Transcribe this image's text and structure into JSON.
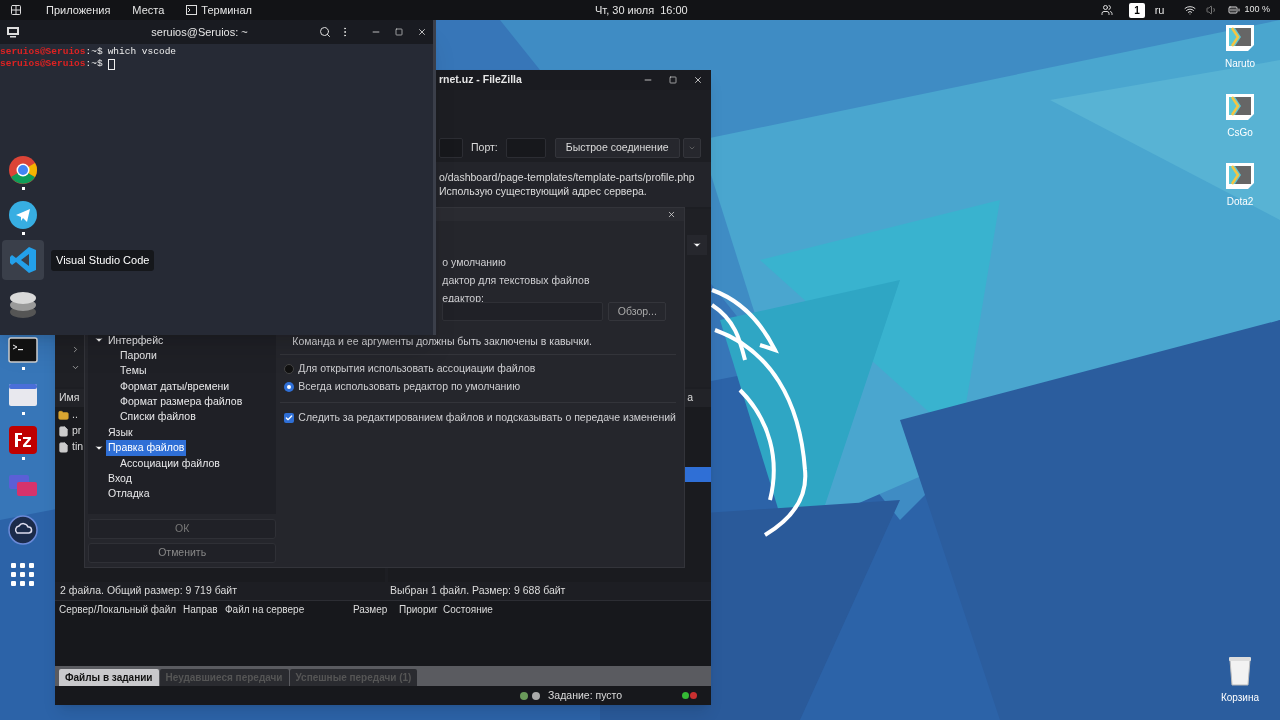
{
  "top_bar": {
    "menus": [
      "Приложения",
      "Места"
    ],
    "app": "Терминал",
    "clock": "Чт, 30 июля  16:00",
    "workspace": "1",
    "language": "ru",
    "battery": "100 %"
  },
  "dock": {
    "items": [
      {
        "kind": "chrome",
        "running": true,
        "highlighted": false
      },
      {
        "kind": "telegram",
        "running": true,
        "highlighted": false
      },
      {
        "kind": "vscode",
        "running": false,
        "highlighted": true
      },
      {
        "kind": "database",
        "running": false,
        "highlighted": false
      },
      {
        "kind": "terminal",
        "running": true,
        "highlighted": false
      },
      {
        "kind": "files",
        "running": true,
        "highlighted": false
      },
      {
        "kind": "filezilla",
        "running": true,
        "highlighted": false
      },
      {
        "kind": "screens",
        "running": false,
        "highlighted": false
      },
      {
        "kind": "cloud",
        "running": false,
        "highlighted": false
      },
      {
        "kind": "grid",
        "running": false,
        "highlighted": false
      }
    ],
    "tooltip": "Visual Studio Code"
  },
  "desktop_icons": [
    {
      "kind": "launcher",
      "label": "Naruto"
    },
    {
      "kind": "launcher",
      "label": "CsGo"
    },
    {
      "kind": "launcher",
      "label": "Dota2"
    },
    {
      "kind": "trash",
      "label": "Корзина"
    }
  ],
  "terminal": {
    "title": "seruios@Seruios: ~",
    "lines": [
      {
        "prompt": "seruios@Seruios",
        "path": ":~$",
        "command": "which vscode",
        "cursor": false
      },
      {
        "prompt": "seruios@Seruios",
        "path": ":~$",
        "cursor": true
      }
    ]
  },
  "filezilla": {
    "title": "rnet.uz - FileZilla",
    "port_label": "Порт:",
    "connect_button": "Быстрое соединение",
    "log": [
      "o/dashboard/page-templates/template-parts/profile.php",
      "Использую существующий адрес сервера."
    ],
    "local_header": "Имя",
    "local_rows": [
      {
        "kind": "folder",
        "name": ".."
      },
      {
        "kind": "file",
        "name": "pr"
      },
      {
        "kind": "file",
        "name": "tin"
      }
    ],
    "remote_header": "а",
    "remote_rows": [
      {
        "selected": false
      },
      {
        "selected": false
      },
      {
        "selected": false
      },
      {
        "selected": false
      },
      {
        "selected": true
      }
    ],
    "local_status": "2 файла. Общий размер: 9 719 байт",
    "remote_status": "Выбран 1 файл. Размер: 9 688 байт",
    "queue_columns": [
      "Сервер/Локальный файл",
      "Направ",
      "Файл на сервере",
      "Размер",
      "Приориг",
      "Состояние"
    ],
    "tabs": [
      {
        "label": "Файлы в задании",
        "selected": true
      },
      {
        "label": "Неудавшиеся передачи",
        "selected": false
      },
      {
        "label": "Успешные передачи (1)",
        "selected": false
      }
    ],
    "queue_status": "Задание: пусто"
  },
  "dialog": {
    "tree": [
      {
        "label": "Интерфейс",
        "selected": false,
        "expanded": true,
        "children": [
          {
            "label": "Пароли",
            "selected": false
          },
          {
            "label": "Темы",
            "selected": false
          },
          {
            "label": "Формат даты/времени",
            "selected": false
          },
          {
            "label": "Формат размера файлов",
            "selected": false
          },
          {
            "label": "Списки файлов",
            "selected": false
          }
        ]
      },
      {
        "label": "Язык",
        "selected": false
      },
      {
        "label": "Правка файлов",
        "selected": true,
        "expanded": true,
        "children": [
          {
            "label": "Ассоциации файлов",
            "selected": false
          }
        ]
      },
      {
        "label": "Вход",
        "selected": false
      },
      {
        "label": "Отладка",
        "selected": false
      }
    ],
    "ok": "ОК",
    "cancel": "Отменить",
    "partial_lines": [
      "о умолчанию",
      "дактор для текстовых файлов",
      "едактор:"
    ],
    "browse": "Обзор...",
    "note": "Команда и ее аргументы должны быть заключены в кавычки.",
    "radios": [
      {
        "label": "Для открытия использовать ассоциации файлов",
        "selected": false
      },
      {
        "label": "Всегда использовать редактор по умолчанию",
        "selected": true
      }
    ],
    "checkbox": {
      "label": "Следить за редактированием файлов и подсказывать о передаче изменений",
      "checked": true
    }
  }
}
